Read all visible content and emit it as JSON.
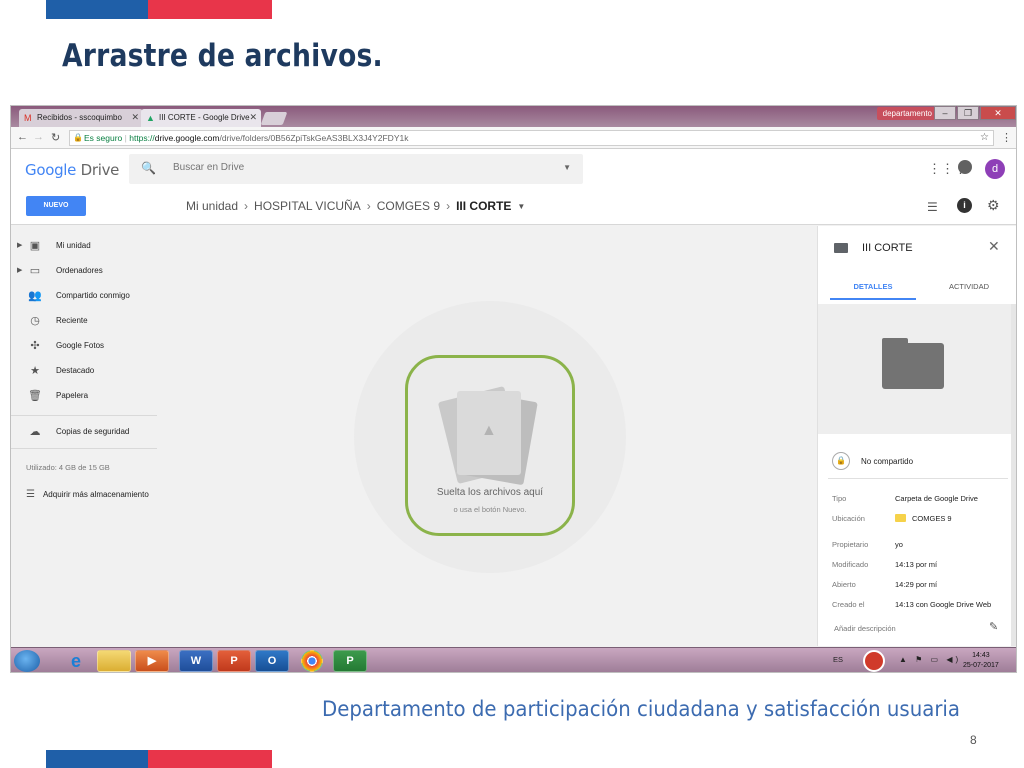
{
  "slide": {
    "title": "Arrastre de archivos.",
    "footer": "Departamento de participación ciudadana y satisfacción usuaria",
    "page_number": "8"
  },
  "browser": {
    "tabs": [
      {
        "label": "Recibidos - sscoquimbo",
        "icon": "gmail-icon",
        "active": false
      },
      {
        "label": "III CORTE - Google Drive",
        "icon": "drive-icon",
        "active": true
      }
    ],
    "profile_chip": "departamento",
    "secure_label": "Es seguro",
    "url_prefix": "https://",
    "url_host": "drive.google.com",
    "url_path": "/drive/folders/0B56ZpiTskGeAS3BLX3J4Y2FDY1k"
  },
  "drive": {
    "logo_google": "Google",
    "logo_drive": "Drive",
    "search_placeholder": "Buscar en Drive",
    "avatar_letter": "d",
    "new_button": "NUEVO",
    "breadcrumb": [
      "Mi unidad",
      "HOSPITAL VICUÑA",
      "COMGES 9",
      "III CORTE"
    ],
    "sidebar": [
      {
        "label": "Mi unidad",
        "icon": "my-drive-icon",
        "expandable": true
      },
      {
        "label": "Ordenadores",
        "icon": "computers-icon",
        "expandable": true
      },
      {
        "label": "Compartido conmigo",
        "icon": "shared-icon",
        "expandable": false
      },
      {
        "label": "Reciente",
        "icon": "clock-icon",
        "expandable": false
      },
      {
        "label": "Google Fotos",
        "icon": "photos-icon",
        "expandable": false
      },
      {
        "label": "Destacado",
        "icon": "star-icon",
        "expandable": false
      },
      {
        "label": "Papelera",
        "icon": "trash-icon",
        "expandable": false
      },
      {
        "label": "Copias de seguridad",
        "icon": "cloud-icon",
        "expandable": false
      }
    ],
    "storage_used": "Utilizado: 4 GB de 15 GB",
    "buy_storage": "Adquirir más almacenamiento",
    "drop_title": "Suelta los archivos aquí",
    "drop_subtitle": "o usa el botón Nuevo."
  },
  "details": {
    "title": "III CORTE",
    "tab_details": "DETALLES",
    "tab_activity": "ACTIVIDAD",
    "sharing": "No compartido",
    "meta": [
      {
        "key": "Tipo",
        "value": "Carpeta de Google Drive"
      },
      {
        "key": "Ubicación",
        "value": "COMGES 9"
      },
      {
        "key": "Propietario",
        "value": "yo"
      },
      {
        "key": "Modificado",
        "value": "14:13 por mí"
      },
      {
        "key": "Abierto",
        "value": "14:29 por mí"
      },
      {
        "key": "Creado el",
        "value": "14:13 con Google Drive Web"
      }
    ],
    "add_description": "Añadir descripción"
  },
  "taskbar": {
    "language": "ES",
    "time": "14:43",
    "date": "25-07-2017",
    "apps": [
      "ie-icon",
      "explorer-icon",
      "media-player-icon",
      "word-icon",
      "powerpoint-icon",
      "outlook-icon",
      "chrome-icon",
      "project-icon"
    ]
  }
}
